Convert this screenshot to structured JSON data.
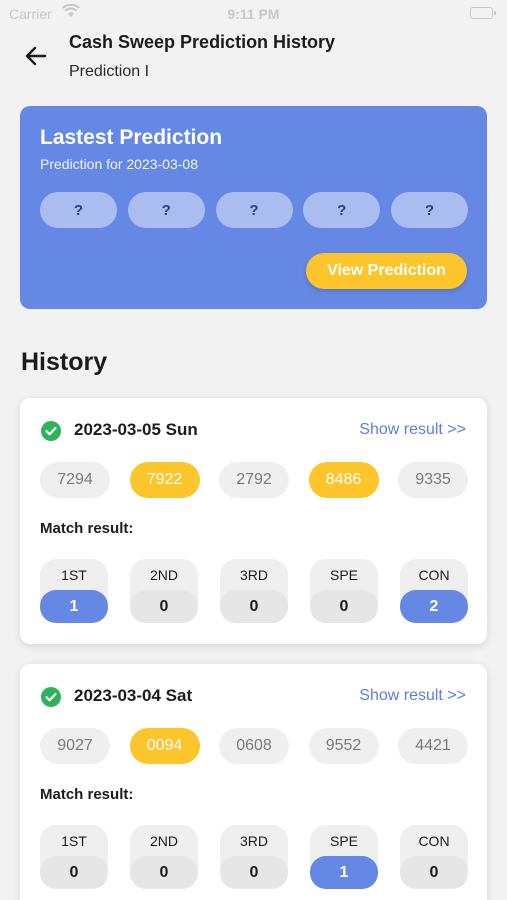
{
  "status_bar": {
    "carrier": "Carrier",
    "time": "9:11 PM"
  },
  "header": {
    "title": "Cash Sweep Prediction History",
    "subtitle": "Prediction I"
  },
  "latest": {
    "title": "Lastest Prediction",
    "subtitle": "Prediction for 2023-03-08",
    "numbers": [
      "?",
      "?",
      "?",
      "?",
      "?"
    ],
    "button_label": "View Prediction"
  },
  "history_heading": "History",
  "history": [
    {
      "date": "2023-03-05 Sun",
      "link_label": "Show result >>",
      "numbers": [
        {
          "value": "7294",
          "hit": false
        },
        {
          "value": "7922",
          "hit": true
        },
        {
          "value": "2792",
          "hit": false
        },
        {
          "value": "8486",
          "hit": true
        },
        {
          "value": "9335",
          "hit": false
        }
      ],
      "match_label": "Match result:",
      "matches": [
        {
          "name": "1ST",
          "value": "1",
          "active": true
        },
        {
          "name": "2ND",
          "value": "0",
          "active": false
        },
        {
          "name": "3RD",
          "value": "0",
          "active": false
        },
        {
          "name": "SPE",
          "value": "0",
          "active": false
        },
        {
          "name": "CON",
          "value": "2",
          "active": true
        }
      ]
    },
    {
      "date": "2023-03-04 Sat",
      "link_label": "Show result >>",
      "numbers": [
        {
          "value": "9027",
          "hit": false
        },
        {
          "value": "0094",
          "hit": true
        },
        {
          "value": "0608",
          "hit": false
        },
        {
          "value": "9552",
          "hit": false
        },
        {
          "value": "4421",
          "hit": false
        }
      ],
      "match_label": "Match result:",
      "matches": [
        {
          "name": "1ST",
          "value": "0",
          "active": false
        },
        {
          "name": "2ND",
          "value": "0",
          "active": false
        },
        {
          "name": "3RD",
          "value": "0",
          "active": false
        },
        {
          "name": "SPE",
          "value": "1",
          "active": true
        },
        {
          "name": "CON",
          "value": "0",
          "active": false
        }
      ]
    }
  ],
  "colors": {
    "accent_blue": "#6488e4",
    "hit_yellow": "#fcc52c",
    "success_green": "#2fb35a",
    "link_blue": "#5b7ee0"
  }
}
